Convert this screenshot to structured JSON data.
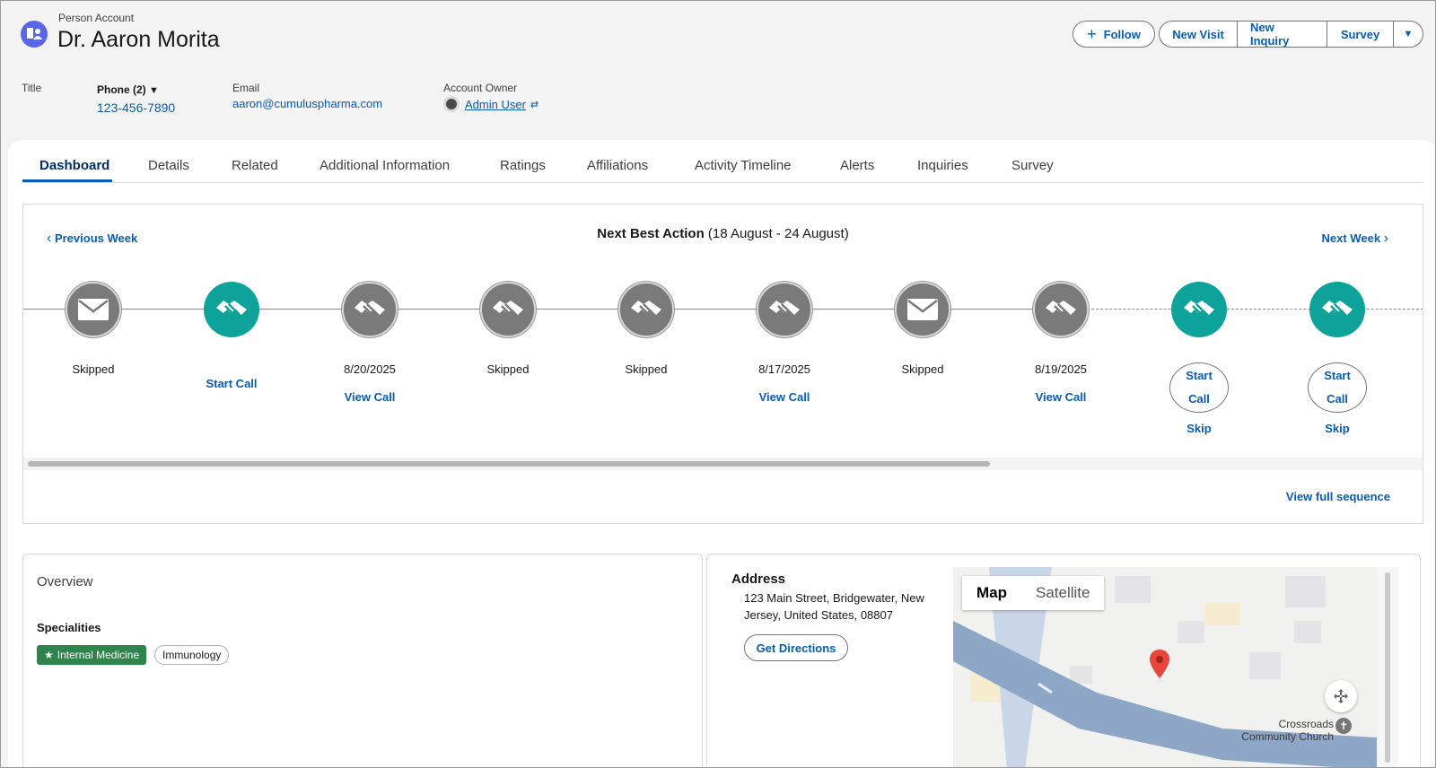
{
  "header": {
    "object_type": "Person Account",
    "name": "Dr. Aaron Morita",
    "icon": "person-account-icon",
    "buttons": {
      "follow": "Follow",
      "new_visit": "New Visit",
      "new_inquiry": "New Inquiry",
      "survey": "Survey"
    }
  },
  "highlights": {
    "title_label": "Title",
    "phone_label": "Phone (2)",
    "phone_value": "123-456-7890",
    "email_label": "Email",
    "email_value": "aaron@cumuluspharma.com",
    "owner_label": "Account Owner",
    "owner_value": "Admin User"
  },
  "tabs": [
    "Dashboard",
    "Details",
    "Related",
    "Additional Information",
    "Ratings",
    "Affiliations",
    "Activity Timeline",
    "Alerts",
    "Inquiries",
    "Survey"
  ],
  "active_tab": "Dashboard",
  "nba": {
    "prev": "Previous Week",
    "next": "Next Week",
    "title_bold": "Next Best Action",
    "title_range": "(18 August - 24 August)",
    "view_full": "View full sequence",
    "steps": [
      {
        "icon": "email-icon",
        "color": "grey",
        "label": "Skipped",
        "link": ""
      },
      {
        "icon": "handshake-icon",
        "color": "teal",
        "label": "",
        "link": "Start Call"
      },
      {
        "icon": "handshake-icon",
        "color": "grey",
        "label": "8/20/2025",
        "link": "View Call"
      },
      {
        "icon": "handshake-icon",
        "color": "grey",
        "label": "Skipped",
        "link": ""
      },
      {
        "icon": "handshake-icon",
        "color": "grey",
        "label": "Skipped",
        "link": ""
      },
      {
        "icon": "handshake-icon",
        "color": "grey",
        "label": "8/17/2025",
        "link": "View Call"
      },
      {
        "icon": "email-icon",
        "color": "grey",
        "label": "Skipped",
        "link": ""
      },
      {
        "icon": "handshake-icon",
        "color": "grey",
        "label": "8/19/2025",
        "link": "View Call"
      },
      {
        "icon": "handshake-icon",
        "color": "teal",
        "start_top": "Start",
        "start_bottom": "Call",
        "skip": "Skip"
      },
      {
        "icon": "handshake-icon",
        "color": "teal",
        "start_top": "Start",
        "start_bottom": "Call",
        "skip": "Skip"
      }
    ]
  },
  "overview": {
    "title": "Overview",
    "specialities_label": "Specialities",
    "primary": "Internal Medicine",
    "secondary": "Immunology"
  },
  "address": {
    "title": "Address",
    "line1": "123 Main Street, Bridgewater, New",
    "line2": "Jersey, United States, 08807",
    "directions": "Get Directions",
    "map_tab_map": "Map",
    "map_tab_satellite": "Satellite",
    "map_label_1": "Crossroads",
    "map_label_2": "Community Church"
  },
  "colors": {
    "brand": "#0b5cab",
    "teal": "#0ea39a",
    "grey_step": "#7a7a7a",
    "badge_green": "#2e844a"
  }
}
